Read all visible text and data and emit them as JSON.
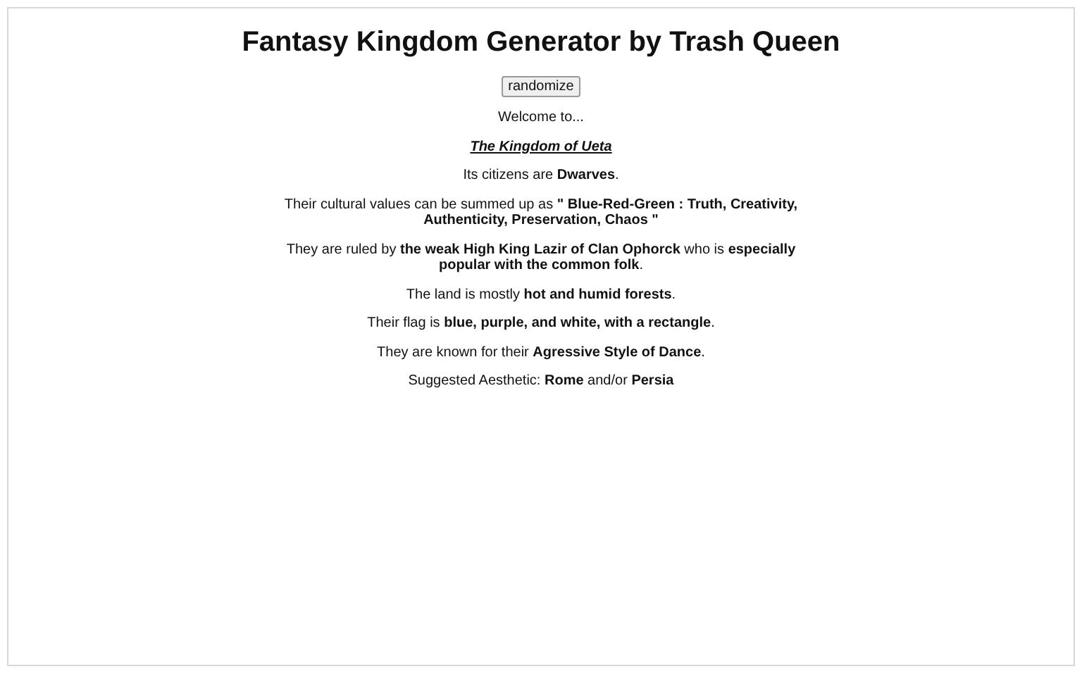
{
  "title": "Fantasy Kingdom Generator by Trash Queen",
  "button": "randomize",
  "welcome": "Welcome to...",
  "kingdom_name": "The Kingdom of Ueta",
  "paragraphs": [
    "Its citizens are **Dwarves**.",
    "Their cultural values can be summed up as **\" Blue-Red-Green : Truth, Creativity, Authenticity, Preservation, Chaos \"**",
    "They are ruled by **the weak High King Lazir of Clan Ophorck** who is **especially popular with the common folk**.",
    "The land is mostly **hot and humid forests**.",
    "Their flag is **blue, purple, and white, with a rectangle**.",
    "They are known for their **Agressive Style of Dance**.",
    "Suggested Aesthetic: **Rome** and/or **Persia**"
  ]
}
